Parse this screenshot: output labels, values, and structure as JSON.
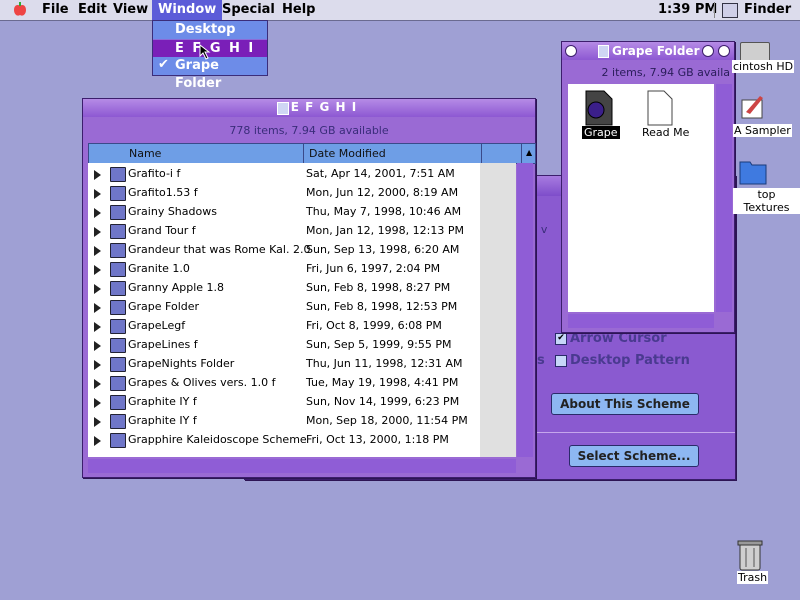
{
  "menubar": {
    "items": [
      "File",
      "Edit",
      "View",
      "Window",
      "Special",
      "Help"
    ],
    "clock": "1:39 PM",
    "app_name": "Finder"
  },
  "window_menu": {
    "items": [
      "Desktop",
      "E F G H I",
      "Grape Folder"
    ],
    "checked": "Grape Folder"
  },
  "main_window": {
    "title": "E F G H I",
    "status": "778 items, 7.94 GB available",
    "columns": [
      "Name",
      "Date Modified"
    ],
    "rows": [
      {
        "name": "Grafito-i f",
        "date": "Sat, Apr 14, 2001, 7:51 AM"
      },
      {
        "name": "Grafito1.53 f",
        "date": "Mon, Jun 12, 2000, 8:19 AM"
      },
      {
        "name": "Grainy Shadows",
        "date": "Thu, May 7, 1998, 10:46 AM"
      },
      {
        "name": "Grand Tour f",
        "date": "Mon, Jan 12, 1998, 12:13 PM"
      },
      {
        "name": "Grandeur that was Rome Kal. 2.0",
        "date": "Sun, Sep 13, 1998, 6:20 AM"
      },
      {
        "name": "Granite 1.0",
        "date": "Fri, Jun 6, 1997, 2:04 PM"
      },
      {
        "name": "Granny Apple 1.8",
        "date": "Sun, Feb 8, 1998, 8:27 PM"
      },
      {
        "name": "Grape Folder",
        "date": "Sun, Feb 8, 1998, 12:53 PM"
      },
      {
        "name": "GrapeLegf",
        "date": "Fri, Oct 8, 1999, 6:08 PM"
      },
      {
        "name": "GrapeLines f",
        "date": "Sun, Sep 5, 1999, 9:55 PM"
      },
      {
        "name": "GrapeNights Folder",
        "date": "Thu, Jun 11, 1998, 12:31 AM"
      },
      {
        "name": "Grapes & Olives vers. 1.0 f",
        "date": "Tue, May 19, 1998, 4:41 PM"
      },
      {
        "name": "Graphite IY f",
        "date": "Sun, Nov 14, 1999, 6:23 PM"
      },
      {
        "name": "Graphite IY f",
        "date": "Mon, Sep 18, 2000, 11:54 PM"
      },
      {
        "name": "Grapphire Kaleidoscope Scheme",
        "date": "Fri, Oct 13, 2000, 1:18 PM"
      }
    ]
  },
  "grape_window": {
    "title": "Grape Folder",
    "status": "2 items, 7.94 GB availa",
    "icons": [
      "Grape",
      "Read Me"
    ]
  },
  "back_panel": {
    "partial_text": "arl v",
    "checkbox1": "Arrow Cursor",
    "checkbox2": "Desktop Pattern",
    "checkbox2_prefix": "s",
    "about_button": "About This Scheme",
    "select_button": "Select Scheme..."
  },
  "desktop_icons": {
    "hd": "cintosh HD",
    "sampler": "A Sampler",
    "textures": "top Textures",
    "trash": "Trash"
  }
}
